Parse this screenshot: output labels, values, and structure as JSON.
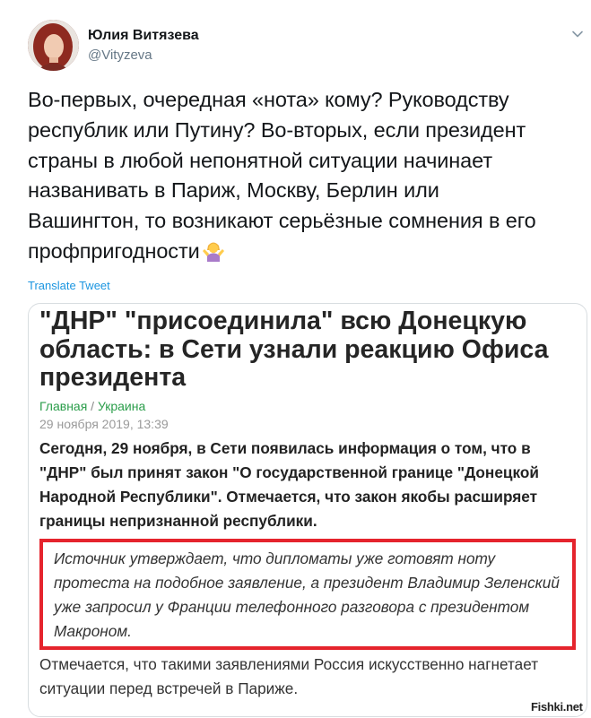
{
  "tweet": {
    "author_name": "Юлия Витязева",
    "author_handle": "@Vityzeva",
    "text_lines": [
      "Во-первых, очередная «нота» кому? Руководству",
      "республик или Путину? Во-вторых, если президент",
      "страны в любой непонятной ситуации начинает",
      "названивать в Париж, Москву, Берлин или",
      "Вашингтон, то возникают серьёзные сомнения в его",
      "профпригодности"
    ],
    "emoji_icon": "person-shrugging-emoji",
    "translate_label": "Translate Tweet"
  },
  "article": {
    "headline_lines": [
      "\"ДНР\" \"присоединила\" всю Донецкую",
      "область: в Сети узнали реакцию Офиса",
      "президента"
    ],
    "breadcrumb_home": "Главная",
    "breadcrumb_sep": " / ",
    "breadcrumb_section": "Украина",
    "date": "29 ноября 2019, 13:39",
    "lead_lines": [
      "Сегодня, 29 ноября, в Сети появилась информация о том, что в",
      "\"ДНР\" был принят закон \"О государственной границе \"Донецкой",
      "Народной Республики\". Отмечается, что закон якобы расширяет",
      "границы непризнанной республики."
    ],
    "quote_lines": [
      "Источник утверждает, что дипломаты уже готовят ноту",
      "протеста на подобное заявление, а президент Владимир Зеленский",
      "уже запросил у Франции телефонного разговора с президентом",
      "Макроном."
    ],
    "footer_lines": [
      "Отмечается, что такими заявлениями Россия искусственно нагнетает",
      "ситуации перед встречей в Париже."
    ]
  },
  "watermark": "Fishki.net",
  "colors": {
    "link_blue": "#1b95e0",
    "highlight_red": "#e5242d",
    "breadcrumb_green": "#2a9d4a",
    "handle_gray": "#657786"
  }
}
